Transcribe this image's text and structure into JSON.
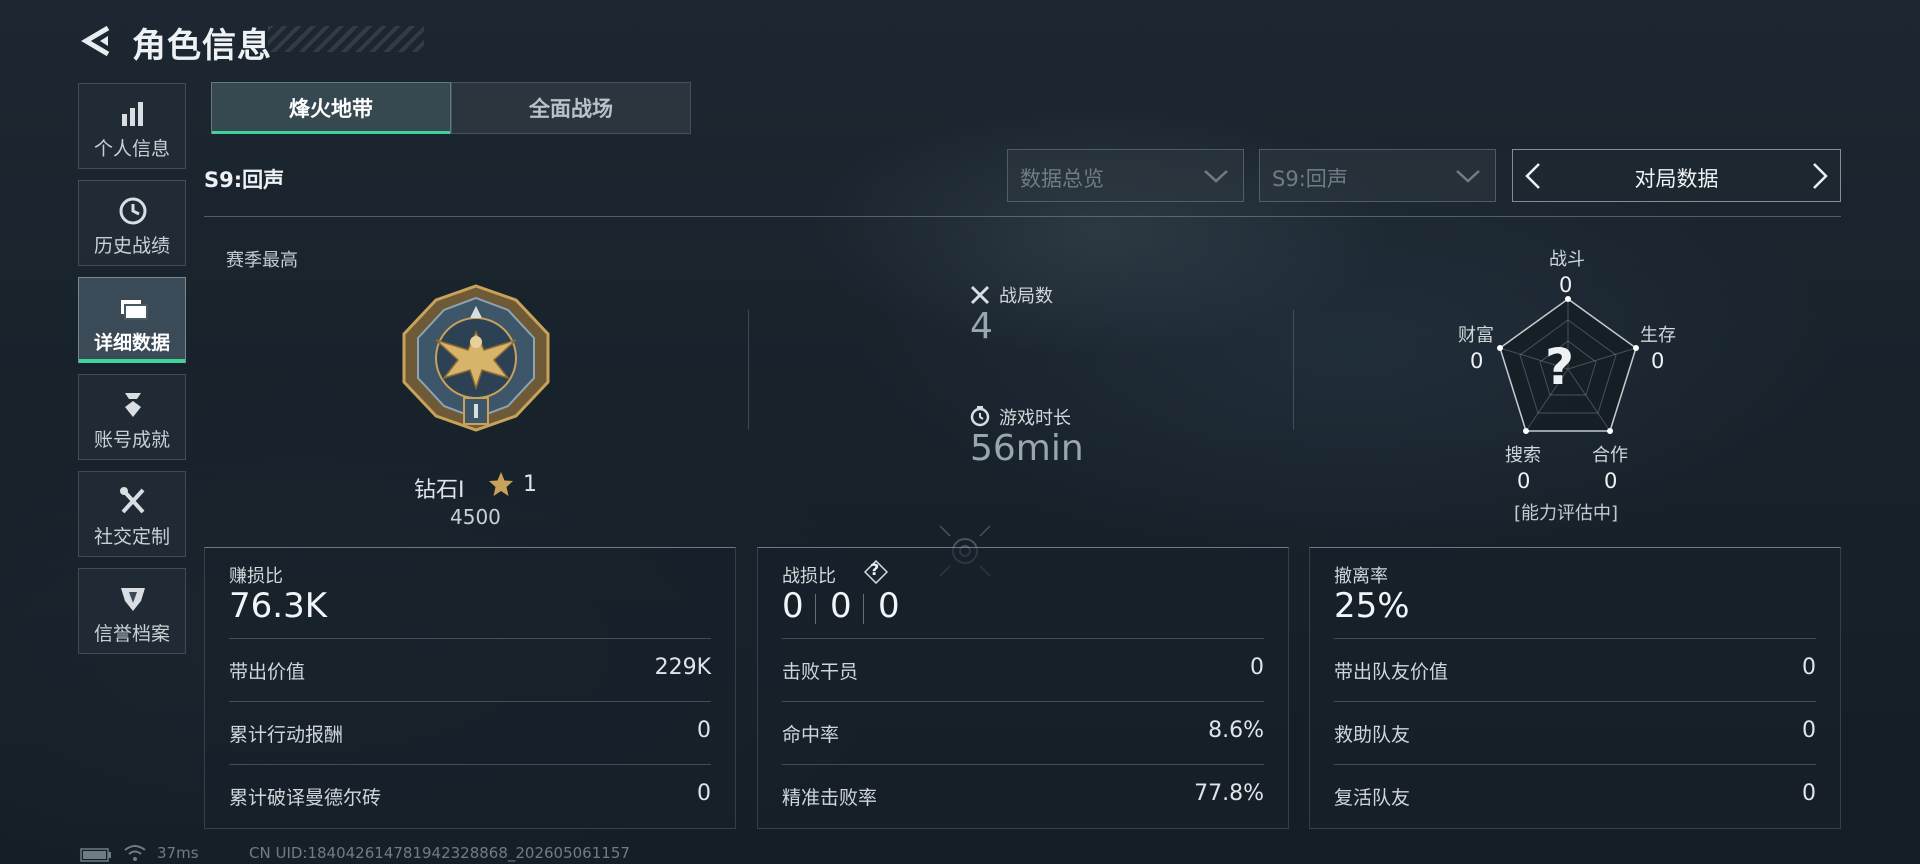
{
  "header": {
    "title": "角色信息"
  },
  "sidebar": {
    "items": [
      {
        "label": "个人信息",
        "icon": "bar-chart-icon"
      },
      {
        "label": "历史战绩",
        "icon": "clock-icon"
      },
      {
        "label": "详细数据",
        "icon": "folder-icon",
        "active": true
      },
      {
        "label": "账号成就",
        "icon": "medal-icon"
      },
      {
        "label": "社交定制",
        "icon": "tools-icon"
      },
      {
        "label": "信誉档案",
        "icon": "shield-icon"
      }
    ]
  },
  "tabs": {
    "items": [
      "烽火地带",
      "全面战场"
    ],
    "active": "烽火地带"
  },
  "season_label": "S9:回声",
  "filters": {
    "overview": "数据总览",
    "season": "S9:回声",
    "pager_label": "对局数据"
  },
  "season_best": {
    "label": "赛季最高",
    "rank_name": "钻石I",
    "stars": "1",
    "points": "4500"
  },
  "match_stats": {
    "matches_label": "战局数",
    "matches_value": "4",
    "duration_label": "游戏时长",
    "duration_value": "56min"
  },
  "radar": {
    "center_glyph": "?",
    "axes": [
      {
        "label": "战斗",
        "value": "0"
      },
      {
        "label": "生存",
        "value": "0"
      },
      {
        "label": "合作",
        "value": "0"
      },
      {
        "label": "搜索",
        "value": "0"
      },
      {
        "label": "财富",
        "value": "0"
      }
    ],
    "status": "[能力评估中]"
  },
  "cards": {
    "profit": {
      "title": "赚损比",
      "value": "76.3K",
      "rows": [
        {
          "k": "带出价值",
          "v": "229K"
        },
        {
          "k": "累计行动报酬",
          "v": "0"
        },
        {
          "k": "累计破译曼德尔砖",
          "v": "0"
        }
      ]
    },
    "combat": {
      "title": "战损比",
      "help_icon": "?",
      "segments": [
        "0",
        "0",
        "0"
      ],
      "rows": [
        {
          "k": "击败干员",
          "v": "0"
        },
        {
          "k": "命中率",
          "v": "8.6%"
        },
        {
          "k": "精准击败率",
          "v": "77.8%"
        }
      ]
    },
    "extract": {
      "title": "撤离率",
      "value": "25%",
      "rows": [
        {
          "k": "带出队友价值",
          "v": "0"
        },
        {
          "k": "救助队友",
          "v": "0"
        },
        {
          "k": "复活队友",
          "v": "0"
        }
      ]
    }
  },
  "footer": {
    "ping": "37ms",
    "uid": "CN UID:18404261478194232886​8_202605061157"
  },
  "colors": {
    "accent": "#3fd39a",
    "background": "#18222b",
    "medal_gold": "#c9a25a"
  }
}
